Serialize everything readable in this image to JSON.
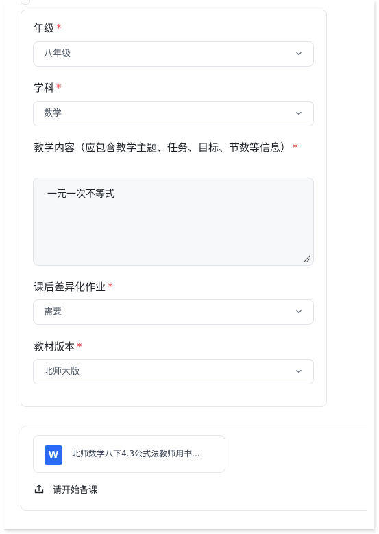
{
  "form": {
    "grade": {
      "label": "年级",
      "required_mark": "*",
      "value": "八年级"
    },
    "subject": {
      "label": "学科",
      "required_mark": "*",
      "value": "数学"
    },
    "content": {
      "label": "教学内容（应包含教学主题、任务、目标、节数等信息）",
      "required_mark": "*",
      "value": "一元一次不等式"
    },
    "homework": {
      "label": "课后差异化作业",
      "required_mark": "*",
      "value": "需要"
    },
    "textbook": {
      "label": "教材版本",
      "required_mark": "*",
      "value": "北师大版"
    }
  },
  "attachment": {
    "icon": "word-doc-icon",
    "icon_letter": "W",
    "icon_color": "#2b6bf3",
    "file_name": "北师数学八下4.3公式法教师用书..."
  },
  "actions": {
    "start_label": "请开始备课",
    "start_icon": "upload-icon"
  },
  "colors": {
    "required": "#f0484a",
    "accent": "#2b6bf3"
  }
}
